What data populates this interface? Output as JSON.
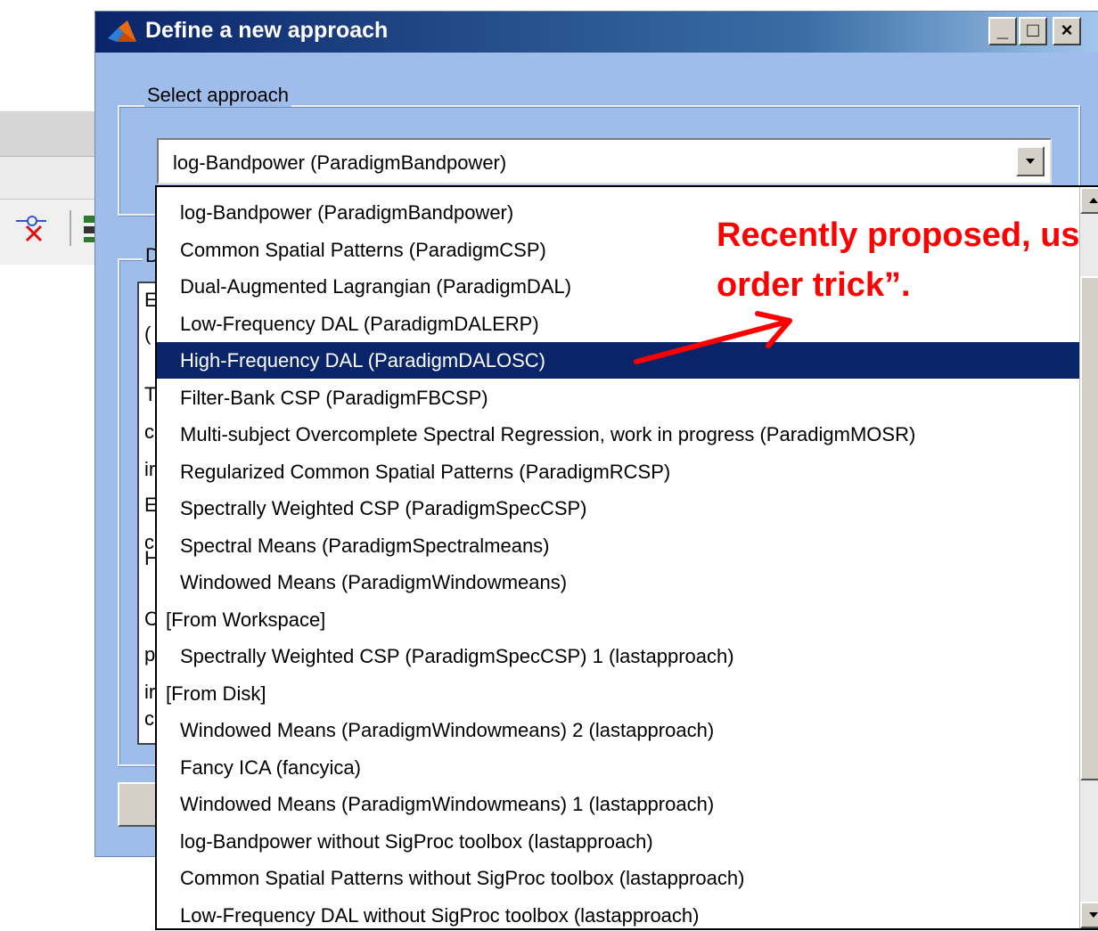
{
  "dialog": {
    "title": "Define a new approach",
    "minimize_label": "_",
    "maximize_label": "□",
    "close_label": "×"
  },
  "select_group": {
    "legend": "Select approach",
    "selected_value": "log-Bandpower (ParadigmBandpower)"
  },
  "description_group": {
    "legend_fragment": "D",
    "text_fragments": [
      "E",
      "(",
      "T",
      "c",
      "ir",
      "E",
      "c",
      "H",
      "C",
      "p",
      "ir",
      "c"
    ]
  },
  "dropdown": {
    "items": [
      {
        "label": "log-Bandpower (ParadigmBandpower)",
        "type": "item",
        "selected": false
      },
      {
        "label": "Common Spatial Patterns (ParadigmCSP)",
        "type": "item",
        "selected": false
      },
      {
        "label": "Dual-Augmented Lagrangian (ParadigmDAL)",
        "type": "item",
        "selected": false
      },
      {
        "label": "Low-Frequency DAL (ParadigmDALERP)",
        "type": "item",
        "selected": false
      },
      {
        "label": "High-Frequency DAL (ParadigmDALOSC)",
        "type": "item",
        "selected": true
      },
      {
        "label": "Filter-Bank CSP (ParadigmFBCSP)",
        "type": "item",
        "selected": false
      },
      {
        "label": "Multi-subject Overcomplete Spectral Regression, work in progress (ParadigmMOSR)",
        "type": "item",
        "selected": false
      },
      {
        "label": "Regularized Common Spatial Patterns (ParadigmRCSP)",
        "type": "item",
        "selected": false
      },
      {
        "label": "Spectrally Weighted CSP (ParadigmSpecCSP)",
        "type": "item",
        "selected": false
      },
      {
        "label": "Spectral Means (ParadigmSpectralmeans)",
        "type": "item",
        "selected": false
      },
      {
        "label": "Windowed Means (ParadigmWindowmeans)",
        "type": "item",
        "selected": false
      },
      {
        "label": "[From Workspace]",
        "type": "group",
        "selected": false
      },
      {
        "label": "Spectrally Weighted CSP (ParadigmSpecCSP) 1 (lastapproach)",
        "type": "item",
        "selected": false
      },
      {
        "label": "[From Disk]",
        "type": "group",
        "selected": false
      },
      {
        "label": "Windowed Means (ParadigmWindowmeans) 2 (lastapproach)",
        "type": "item",
        "selected": false
      },
      {
        "label": "Fancy ICA (fancyica)",
        "type": "item",
        "selected": false
      },
      {
        "label": "Windowed Means (ParadigmWindowmeans) 1 (lastapproach)",
        "type": "item",
        "selected": false
      },
      {
        "label": "log-Bandpower without SigProc toolbox (lastapproach)",
        "type": "item",
        "selected": false
      },
      {
        "label": "Common Spatial Patterns without SigProc toolbox (lastapproach)",
        "type": "item",
        "selected": false
      },
      {
        "label": "Low-Frequency DAL without SigProc toolbox (lastapproach)",
        "type": "item",
        "selected": false
      }
    ]
  },
  "annotation": {
    "line1": "Recently proposed, us",
    "line2": "order trick”.",
    "color": "#ff0000"
  },
  "colors": {
    "dialog_bg": "#9fbdea",
    "titlebar": "#0a246a",
    "selection": "#0a246a"
  },
  "icons": [
    "matlab-icon",
    "minimize-icon",
    "maximize-icon",
    "close-icon",
    "dropdown-arrow-icon",
    "scroll-up-icon",
    "scroll-down-icon",
    "remove-link-icon",
    "toolbar-icon"
  ]
}
